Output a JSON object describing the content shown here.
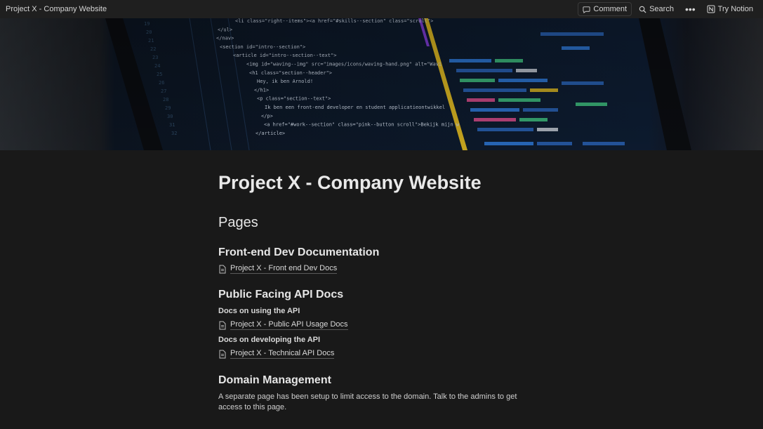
{
  "topbar": {
    "title": "Project X - Company Website",
    "comment_label": "Comment",
    "search_label": "Search",
    "more_label": "•••",
    "try_notion_label": "Try Notion"
  },
  "cover": {
    "code_lines": [
      "<li class=\"right--items\"><a href=\"#skills--section\" class=\"scroll\">",
      "</ul>",
      "</nav>",
      "<section id=\"intro--section\">",
      "<article id=\"intro--section--text\">",
      "<img id=\"waving--img\" src=\"images/icons/waving-hand.png\" alt=\"Wavi",
      "<h1 class=\"section--header\">",
      "Hey, ik ben Arnold!",
      "</h1>",
      "<p class=\"section--text\">",
      "Ik ben een front-end developer en student applicatieontwikkel",
      "</p>",
      "<a href=\"#work--section\" class=\"pink--button scroll\">Bekijk mijn w",
      "</article>"
    ]
  },
  "page": {
    "title": "Project X - Company Website",
    "pages_heading": "Pages",
    "sections": {
      "frontend_heading": "Front-end Dev Documentation",
      "frontend_link": "Project X - Front end Dev Docs",
      "api_heading": "Public Facing API Docs",
      "api_usage_label": "Docs on using the API",
      "api_usage_link": "Project X - Public API Usage Docs",
      "api_dev_label": "Docs on developing the API",
      "api_dev_link": "Project X - Technical API Docs",
      "domain_heading": "Domain Management",
      "domain_text": "A separate page has been setup to limit access to the domain. Talk to the admins to get access to this page."
    }
  }
}
